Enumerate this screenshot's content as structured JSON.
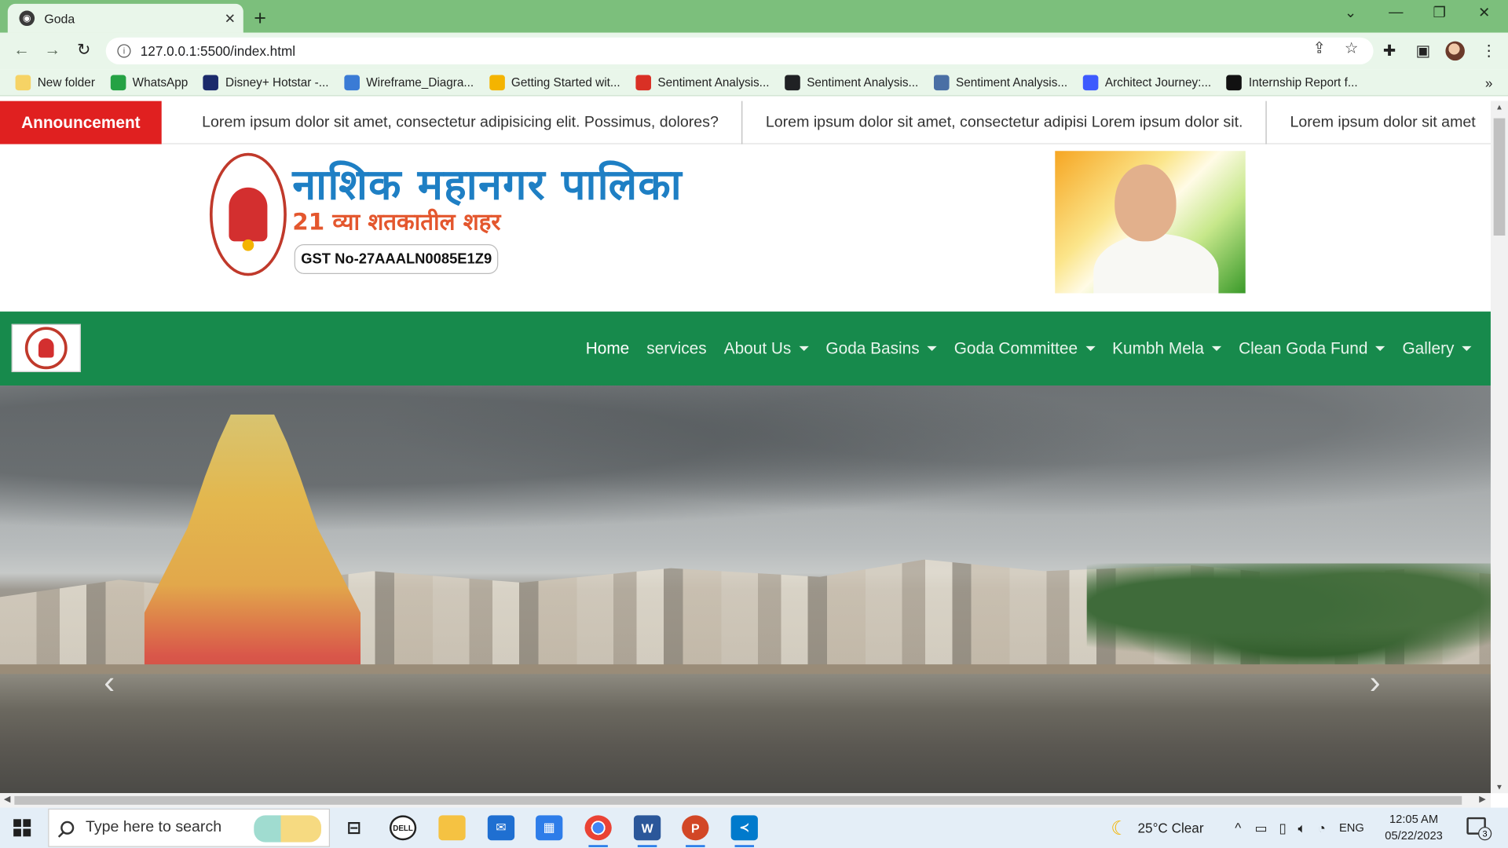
{
  "browser": {
    "tab_title": "Goda",
    "tab_close": "✕",
    "new_tab": "+",
    "url": "127.0.0.1:5500/index.html",
    "bookmarks": [
      {
        "label": "New folder",
        "color": "#f6d365",
        "icon": "folder-icon"
      },
      {
        "label": "WhatsApp",
        "color": "#25a244",
        "icon": "whatsapp-icon"
      },
      {
        "label": "Disney+ Hotstar -...",
        "color": "#1b2a6b",
        "icon": "hotstar-icon"
      },
      {
        "label": "Wireframe_Diagra...",
        "color": "#3a7bd5",
        "icon": "diamond-icon"
      },
      {
        "label": "Getting Started wit...",
        "color": "#f4b400",
        "icon": "smiley-icon"
      },
      {
        "label": "Sentiment Analysis...",
        "color": "#d93025",
        "icon": "pdf-icon"
      },
      {
        "label": "Sentiment Analysis...",
        "color": "#202124",
        "icon": "globe-icon"
      },
      {
        "label": "Sentiment Analysis...",
        "color": "#4a6fa5",
        "icon": "chart-icon"
      },
      {
        "label": "Architect Journey:...",
        "color": "#3d5afe",
        "icon": "q-icon"
      },
      {
        "label": "Internship Report f...",
        "color": "#111111",
        "icon": "notion-icon"
      }
    ],
    "more": "»"
  },
  "site": {
    "announcement_label": "Announcement",
    "ticker": [
      "Lorem ipsum dolor sit amet, consectetur adipisicing elit. Possimus, dolores?",
      "Lorem ipsum dolor sit amet, consectetur adipisi Lorem ipsum dolor sit.",
      "Lorem ipsum dolor sit amet"
    ],
    "title_marathi": "नाशिक महानगर पालिका",
    "subtitle_marathi": "21 व्या शतकातील शहर",
    "gst": "GST No-27AAALN0085E1Z9",
    "menu": [
      {
        "label": "Home",
        "dropdown": false,
        "active": true
      },
      {
        "label": "services",
        "dropdown": false,
        "active": false
      },
      {
        "label": "About Us",
        "dropdown": true,
        "active": false
      },
      {
        "label": "Goda Basins",
        "dropdown": true,
        "active": false
      },
      {
        "label": "Goda Committee",
        "dropdown": true,
        "active": false
      },
      {
        "label": "Kumbh Mela",
        "dropdown": true,
        "active": false
      },
      {
        "label": "Clean Goda Fund",
        "dropdown": true,
        "active": false
      },
      {
        "label": "Gallery",
        "dropdown": true,
        "active": false
      }
    ],
    "carousel_prev": "‹",
    "carousel_next": "›"
  },
  "taskbar": {
    "search_placeholder": "Type here to search",
    "weather": "25°C  Clear",
    "lang": "ENG",
    "time": "12:05 AM",
    "date": "05/22/2023",
    "notifications": "3"
  },
  "colors": {
    "announcement": "#e02020",
    "navbar": "#178a4c",
    "chrome_frame": "#7cbf7c"
  }
}
